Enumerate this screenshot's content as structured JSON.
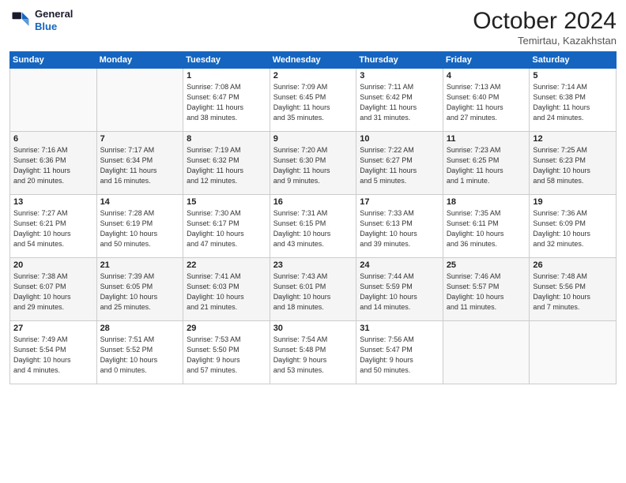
{
  "header": {
    "logo_line1": "General",
    "logo_line2": "Blue",
    "month": "October 2024",
    "location": "Temirtau, Kazakhstan"
  },
  "weekdays": [
    "Sunday",
    "Monday",
    "Tuesday",
    "Wednesday",
    "Thursday",
    "Friday",
    "Saturday"
  ],
  "weeks": [
    [
      {
        "day": "",
        "info": ""
      },
      {
        "day": "",
        "info": ""
      },
      {
        "day": "1",
        "info": "Sunrise: 7:08 AM\nSunset: 6:47 PM\nDaylight: 11 hours\nand 38 minutes."
      },
      {
        "day": "2",
        "info": "Sunrise: 7:09 AM\nSunset: 6:45 PM\nDaylight: 11 hours\nand 35 minutes."
      },
      {
        "day": "3",
        "info": "Sunrise: 7:11 AM\nSunset: 6:42 PM\nDaylight: 11 hours\nand 31 minutes."
      },
      {
        "day": "4",
        "info": "Sunrise: 7:13 AM\nSunset: 6:40 PM\nDaylight: 11 hours\nand 27 minutes."
      },
      {
        "day": "5",
        "info": "Sunrise: 7:14 AM\nSunset: 6:38 PM\nDaylight: 11 hours\nand 24 minutes."
      }
    ],
    [
      {
        "day": "6",
        "info": "Sunrise: 7:16 AM\nSunset: 6:36 PM\nDaylight: 11 hours\nand 20 minutes."
      },
      {
        "day": "7",
        "info": "Sunrise: 7:17 AM\nSunset: 6:34 PM\nDaylight: 11 hours\nand 16 minutes."
      },
      {
        "day": "8",
        "info": "Sunrise: 7:19 AM\nSunset: 6:32 PM\nDaylight: 11 hours\nand 12 minutes."
      },
      {
        "day": "9",
        "info": "Sunrise: 7:20 AM\nSunset: 6:30 PM\nDaylight: 11 hours\nand 9 minutes."
      },
      {
        "day": "10",
        "info": "Sunrise: 7:22 AM\nSunset: 6:27 PM\nDaylight: 11 hours\nand 5 minutes."
      },
      {
        "day": "11",
        "info": "Sunrise: 7:23 AM\nSunset: 6:25 PM\nDaylight: 11 hours\nand 1 minute."
      },
      {
        "day": "12",
        "info": "Sunrise: 7:25 AM\nSunset: 6:23 PM\nDaylight: 10 hours\nand 58 minutes."
      }
    ],
    [
      {
        "day": "13",
        "info": "Sunrise: 7:27 AM\nSunset: 6:21 PM\nDaylight: 10 hours\nand 54 minutes."
      },
      {
        "day": "14",
        "info": "Sunrise: 7:28 AM\nSunset: 6:19 PM\nDaylight: 10 hours\nand 50 minutes."
      },
      {
        "day": "15",
        "info": "Sunrise: 7:30 AM\nSunset: 6:17 PM\nDaylight: 10 hours\nand 47 minutes."
      },
      {
        "day": "16",
        "info": "Sunrise: 7:31 AM\nSunset: 6:15 PM\nDaylight: 10 hours\nand 43 minutes."
      },
      {
        "day": "17",
        "info": "Sunrise: 7:33 AM\nSunset: 6:13 PM\nDaylight: 10 hours\nand 39 minutes."
      },
      {
        "day": "18",
        "info": "Sunrise: 7:35 AM\nSunset: 6:11 PM\nDaylight: 10 hours\nand 36 minutes."
      },
      {
        "day": "19",
        "info": "Sunrise: 7:36 AM\nSunset: 6:09 PM\nDaylight: 10 hours\nand 32 minutes."
      }
    ],
    [
      {
        "day": "20",
        "info": "Sunrise: 7:38 AM\nSunset: 6:07 PM\nDaylight: 10 hours\nand 29 minutes."
      },
      {
        "day": "21",
        "info": "Sunrise: 7:39 AM\nSunset: 6:05 PM\nDaylight: 10 hours\nand 25 minutes."
      },
      {
        "day": "22",
        "info": "Sunrise: 7:41 AM\nSunset: 6:03 PM\nDaylight: 10 hours\nand 21 minutes."
      },
      {
        "day": "23",
        "info": "Sunrise: 7:43 AM\nSunset: 6:01 PM\nDaylight: 10 hours\nand 18 minutes."
      },
      {
        "day": "24",
        "info": "Sunrise: 7:44 AM\nSunset: 5:59 PM\nDaylight: 10 hours\nand 14 minutes."
      },
      {
        "day": "25",
        "info": "Sunrise: 7:46 AM\nSunset: 5:57 PM\nDaylight: 10 hours\nand 11 minutes."
      },
      {
        "day": "26",
        "info": "Sunrise: 7:48 AM\nSunset: 5:56 PM\nDaylight: 10 hours\nand 7 minutes."
      }
    ],
    [
      {
        "day": "27",
        "info": "Sunrise: 7:49 AM\nSunset: 5:54 PM\nDaylight: 10 hours\nand 4 minutes."
      },
      {
        "day": "28",
        "info": "Sunrise: 7:51 AM\nSunset: 5:52 PM\nDaylight: 10 hours\nand 0 minutes."
      },
      {
        "day": "29",
        "info": "Sunrise: 7:53 AM\nSunset: 5:50 PM\nDaylight: 9 hours\nand 57 minutes."
      },
      {
        "day": "30",
        "info": "Sunrise: 7:54 AM\nSunset: 5:48 PM\nDaylight: 9 hours\nand 53 minutes."
      },
      {
        "day": "31",
        "info": "Sunrise: 7:56 AM\nSunset: 5:47 PM\nDaylight: 9 hours\nand 50 minutes."
      },
      {
        "day": "",
        "info": ""
      },
      {
        "day": "",
        "info": ""
      }
    ]
  ]
}
